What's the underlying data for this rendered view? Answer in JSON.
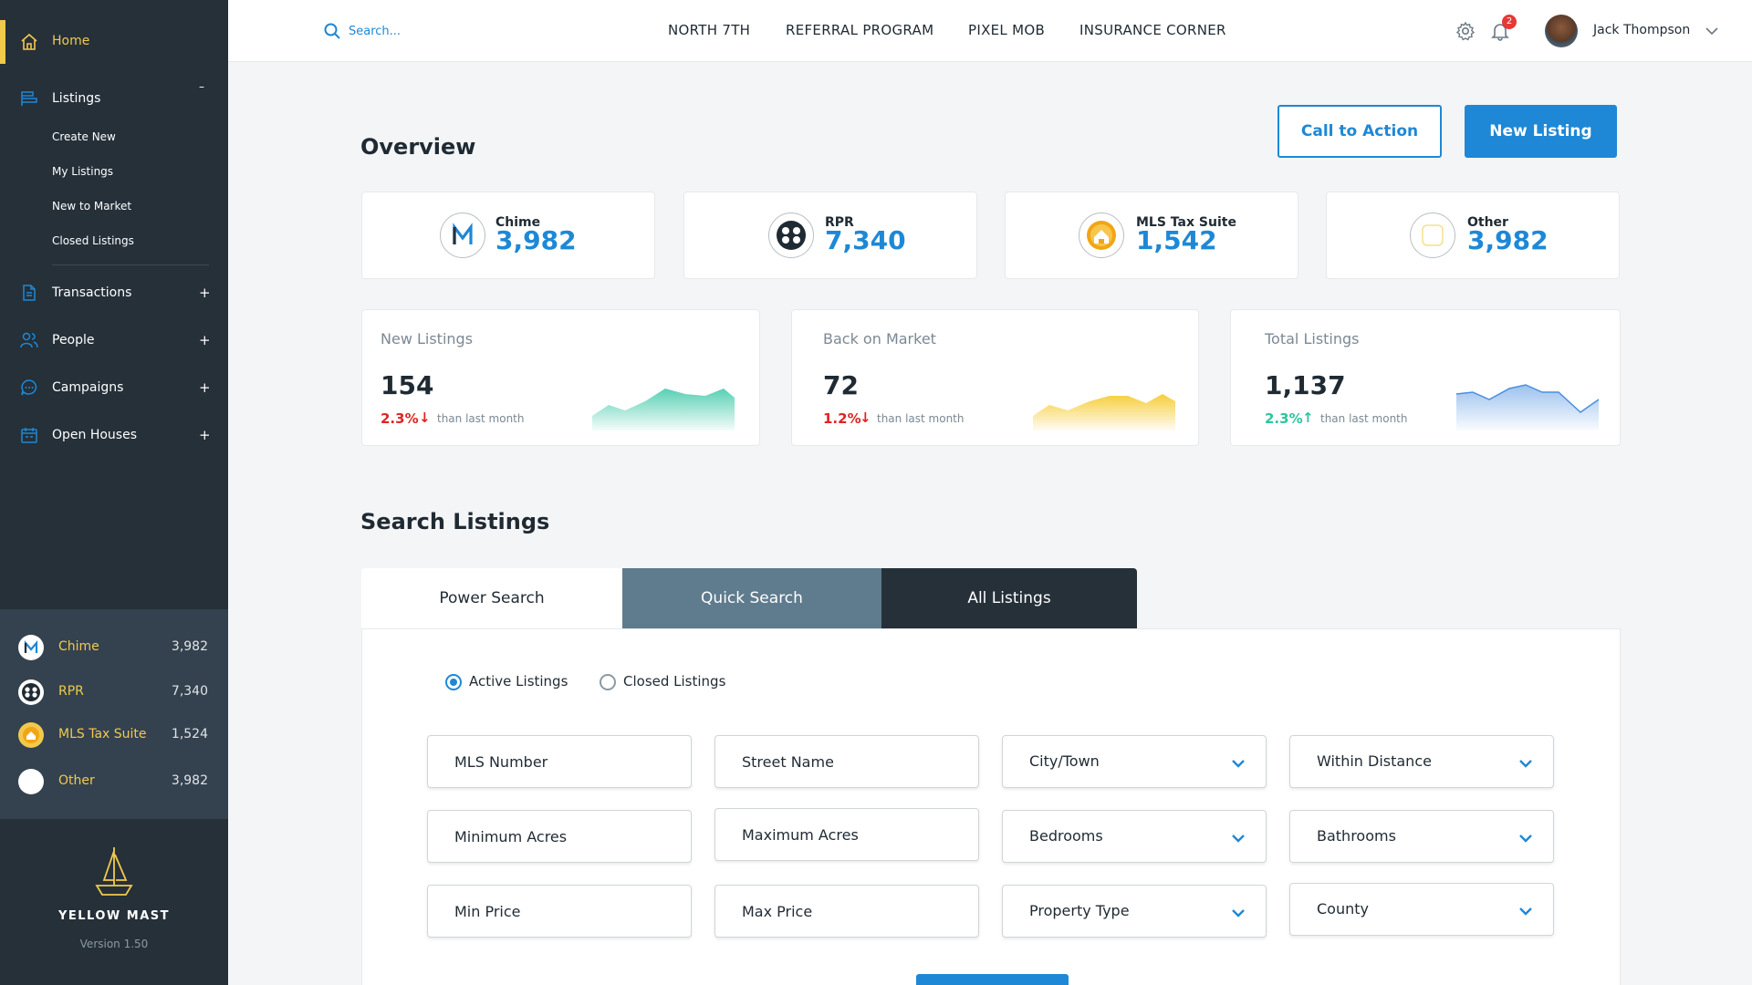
{
  "sidebar": {
    "home_label": "Home",
    "listings_label": "Listings",
    "listings_toggle": "–",
    "listings_sub": [
      "Create New",
      "My Listings",
      "New to Market",
      "Closed Listings"
    ],
    "transactions_label": "Transactions",
    "people_label": "People",
    "campaigns_label": "Campaigns",
    "open_houses_label": "Open Houses",
    "expand_symbol": "+",
    "sources": [
      {
        "name": "Chime",
        "count": "3,982"
      },
      {
        "name": "RPR",
        "count": "7,340"
      },
      {
        "name": "MLS Tax Suite",
        "count": "1,524"
      },
      {
        "name": "Other",
        "count": "3,982"
      }
    ],
    "brand_name": "YELLOW MAST",
    "version": "Version 1.50"
  },
  "topbar": {
    "search_placeholder": "Search...",
    "nav": [
      "NORTH 7TH",
      "REFERRAL PROGRAM",
      "PIXEL MOB",
      "INSURANCE CORNER"
    ],
    "notification_count": "2",
    "user_name": "Jack Thompson"
  },
  "overview": {
    "title": "Overview",
    "cta_label": "Call to Action",
    "new_listing_label": "New Listing",
    "sources": [
      {
        "label": "Chime",
        "value": "3,982"
      },
      {
        "label": "RPR",
        "value": "7,340"
      },
      {
        "label": "MLS Tax Suite",
        "value": "1,542"
      },
      {
        "label": "Other",
        "value": "3,982"
      }
    ],
    "stats": [
      {
        "title": "New Listings",
        "value": "154",
        "change": "2.3%",
        "direction": "down",
        "note": "than last month",
        "color": "#2ec4a0"
      },
      {
        "title": "Back on Market",
        "value": "72",
        "change": "1.2%",
        "direction": "down",
        "note": "than last month",
        "color": "#f5c518"
      },
      {
        "title": "Total Listings",
        "value": "1,137",
        "change": "2.3%",
        "direction": "up",
        "note": "than last month",
        "color": "#4a8fe0"
      }
    ]
  },
  "search_listings": {
    "title": "Search Listings",
    "tabs": [
      "Power Search",
      "Quick Search",
      "All Listings"
    ],
    "radio_active": "Active Listings",
    "radio_closed": "Closed Listings",
    "fields": {
      "mls_number": "MLS Number",
      "street_name": "Street Name",
      "city_town": "City/Town",
      "within_distance": "Within Distance",
      "min_acres": "Minimum Acres",
      "max_acres": "Maximum Acres",
      "bedrooms": "Bedrooms",
      "bathrooms": "Bathrooms",
      "min_price": "Min Price",
      "max_price": "Max Price",
      "property_type": "Property Type",
      "county": "County"
    }
  },
  "colors": {
    "accent": "#1e88d6",
    "sidebar": "#253039",
    "highlight": "#f2c94c",
    "down": "#e02424",
    "up": "#2ec4a0"
  }
}
